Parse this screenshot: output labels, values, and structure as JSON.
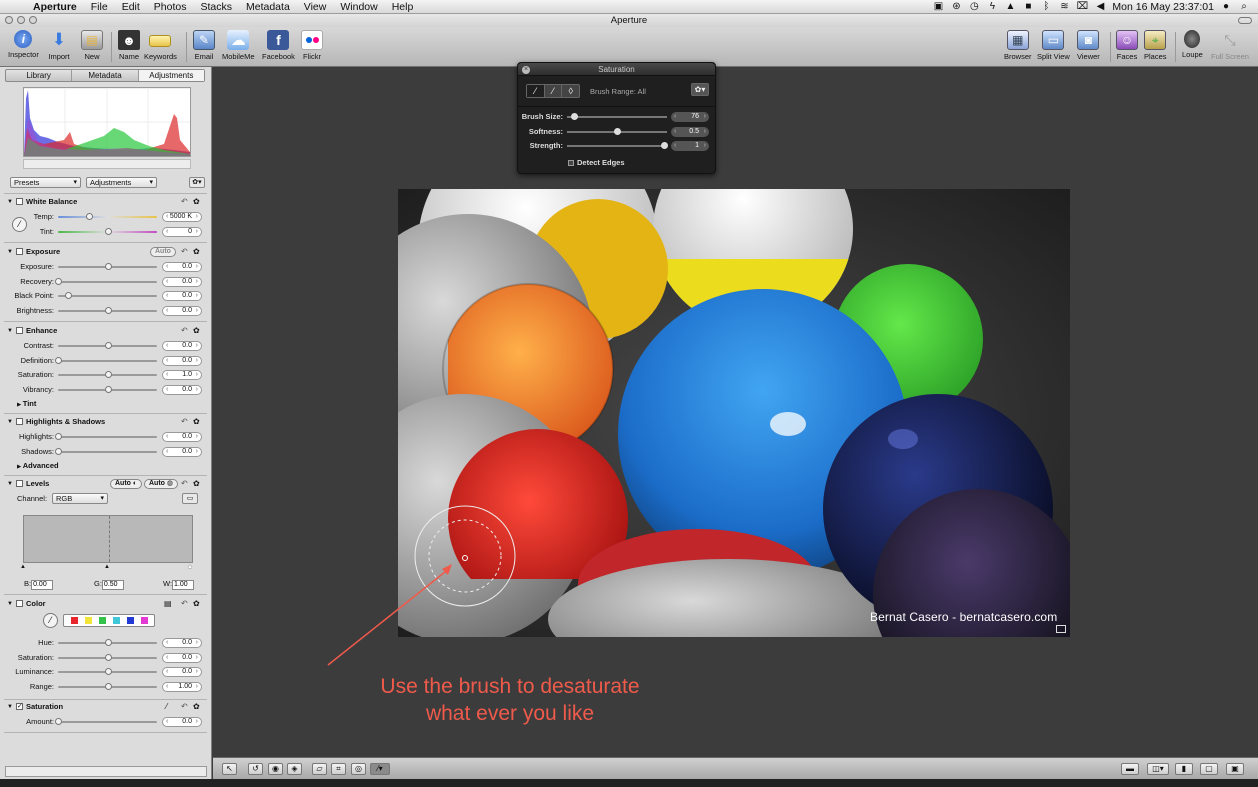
{
  "menubar": {
    "app": "Aperture",
    "items": [
      "File",
      "Edit",
      "Photos",
      "Stacks",
      "Metadata",
      "View",
      "Window",
      "Help"
    ],
    "clock": "Mon 16 May  23:37:01"
  },
  "window": {
    "title": "Aperture"
  },
  "toolbar": {
    "left": [
      {
        "label": "Inspector",
        "icon": "info-icon"
      },
      {
        "label": "Import",
        "icon": "import-arrow-icon"
      },
      {
        "label": "New",
        "icon": "new-project-icon"
      },
      {
        "label": "Name",
        "icon": "name-person-icon"
      },
      {
        "label": "Keywords",
        "icon": "keyword-tag-icon"
      },
      {
        "label": "Email",
        "icon": "email-icon"
      },
      {
        "label": "MobileMe",
        "icon": "mobileme-cloud-icon"
      },
      {
        "label": "Facebook",
        "icon": "facebook-icon"
      },
      {
        "label": "Flickr",
        "icon": "flickr-icon"
      }
    ],
    "right": [
      {
        "label": "Browser",
        "icon": "browser-grid-icon"
      },
      {
        "label": "Split View",
        "icon": "split-view-icon"
      },
      {
        "label": "Viewer",
        "icon": "viewer-icon"
      },
      {
        "label": "Faces",
        "icon": "faces-icon"
      },
      {
        "label": "Places",
        "icon": "places-map-icon"
      },
      {
        "label": "Loupe",
        "icon": "loupe-icon"
      },
      {
        "label": "Full Screen",
        "icon": "full-screen-icon"
      }
    ]
  },
  "inspector": {
    "tabs": [
      "Library",
      "Metadata",
      "Adjustments"
    ],
    "active_tab": "Adjustments",
    "presets_label": "Presets",
    "adjustments_label": "Adjustments",
    "white_balance": {
      "title": "White Balance",
      "temp_label": "Temp:",
      "temp_value": "5000 K",
      "temp_pos": 0.31,
      "tint_label": "Tint:",
      "tint_value": "0",
      "tint_pos": 0.5
    },
    "exposure": {
      "title": "Exposure",
      "auto_label": "Auto",
      "rows": [
        {
          "label": "Exposure:",
          "value": "0.0",
          "pos": 0.5
        },
        {
          "label": "Recovery:",
          "value": "0.0",
          "pos": 0.0
        },
        {
          "label": "Black Point:",
          "value": "0.0",
          "pos": 0.1
        },
        {
          "label": "Brightness:",
          "value": "0.0",
          "pos": 0.5
        }
      ]
    },
    "enhance": {
      "title": "Enhance",
      "rows": [
        {
          "label": "Contrast:",
          "value": "0.0",
          "pos": 0.5
        },
        {
          "label": "Definition:",
          "value": "0.0",
          "pos": 0.0
        },
        {
          "label": "Saturation:",
          "value": "1.0",
          "pos": 0.5
        },
        {
          "label": "Vibrancy:",
          "value": "0.0",
          "pos": 0.5
        }
      ],
      "tint_label": "Tint"
    },
    "highlights_shadows": {
      "title": "Highlights & Shadows",
      "rows": [
        {
          "label": "Highlights:",
          "value": "0.0",
          "pos": 0.0
        },
        {
          "label": "Shadows:",
          "value": "0.0",
          "pos": 0.0
        }
      ],
      "advanced_label": "Advanced"
    },
    "levels": {
      "title": "Levels",
      "auto1": "Auto",
      "auto2": "Auto",
      "channel_label": "Channel:",
      "channel_value": "RGB",
      "b_label": "B:",
      "b_value": "0.00",
      "g_label": "G:",
      "g_value": "0.50",
      "w_label": "W:",
      "w_value": "1.00"
    },
    "color": {
      "title": "Color",
      "swatches": [
        "#e8262c",
        "#f2e53a",
        "#35c24a",
        "#41c8d8",
        "#2239d3",
        "#e23ad3"
      ],
      "rows": [
        {
          "label": "Hue:",
          "value": "0.0",
          "pos": 0.5
        },
        {
          "label": "Saturation:",
          "value": "0.0",
          "pos": 0.5
        },
        {
          "label": "Luminance:",
          "value": "0.0",
          "pos": 0.5
        },
        {
          "label": "Range:",
          "value": "1.00",
          "pos": 0.5
        }
      ]
    },
    "saturation": {
      "title": "Saturation",
      "checked": true,
      "amount_label": "Amount:",
      "amount_value": "0.0",
      "amount_pos": 0.0
    }
  },
  "hud": {
    "title": "Saturation",
    "brush_range": "Brush Range: All",
    "rows": [
      {
        "label": "Brush Size:",
        "value": "76",
        "pos": 0.07
      },
      {
        "label": "Softness:",
        "value": "0.5",
        "pos": 0.5
      },
      {
        "label": "Strength:",
        "value": "1",
        "pos": 0.97
      }
    ],
    "detect_edges": "Detect Edges"
  },
  "photo": {
    "watermark": "Bernat Casero - bernatcasero.com"
  },
  "annotation": {
    "line1": "Use the brush to desaturate",
    "line2": "what ever you like",
    "color": "#ef5a4b"
  }
}
